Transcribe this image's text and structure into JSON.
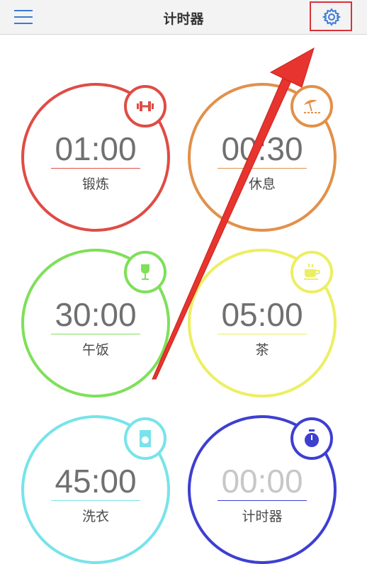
{
  "app": {
    "title": "计时器"
  },
  "timers": [
    {
      "time": "01:00",
      "label": "锻炼",
      "color": "#df4c45",
      "icon": "dumbbell-icon"
    },
    {
      "time": "00:30",
      "label": "休息",
      "color": "#e2904a",
      "icon": "beach-umbrella-icon"
    },
    {
      "time": "30:00",
      "label": "午饭",
      "color": "#7ee05a",
      "icon": "wine-glass-icon"
    },
    {
      "time": "05:00",
      "label": "茶",
      "color": "#ecef62",
      "icon": "tea-cup-icon"
    },
    {
      "time": "45:00",
      "label": "洗衣",
      "color": "#78e3ea",
      "icon": "washing-machine-icon"
    },
    {
      "time": "00:00",
      "label": "计时器",
      "color": "#3d3fd1",
      "icon": "stopwatch-icon"
    }
  ]
}
